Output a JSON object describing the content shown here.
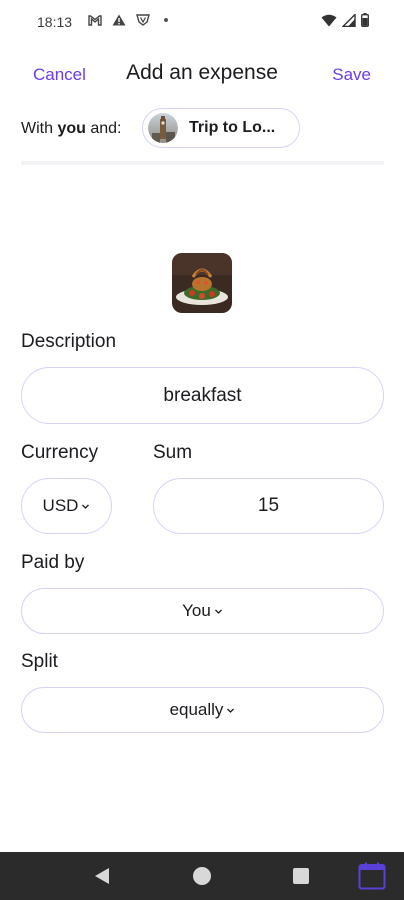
{
  "status_bar": {
    "time": "18:13"
  },
  "header": {
    "cancel_label": "Cancel",
    "title": "Add an expense",
    "save_label": "Save"
  },
  "with_row": {
    "prefix": "With ",
    "you": "you",
    "suffix": " and:",
    "group_name": "Trip to Lo..."
  },
  "form": {
    "description_label": "Description",
    "description_value": "breakfast",
    "currency_label": "Currency",
    "currency_value": "USD",
    "sum_label": "Sum",
    "sum_value": "15",
    "paid_by_label": "Paid by",
    "paid_by_value": "You",
    "split_label": "Split",
    "split_value": "equally"
  },
  "colors": {
    "accent": "#6a3de8",
    "field_border": "#d9d2f7",
    "nav_bar": "#2b2b2b"
  },
  "icons": {
    "status_left": [
      "gmail-icon",
      "warning-icon",
      "shield-icon",
      "dot-icon"
    ],
    "status_right": [
      "wifi-icon",
      "signal-icon",
      "battery-icon"
    ],
    "nav": [
      "back-icon",
      "home-icon",
      "recents-icon",
      "calendar-icon"
    ]
  }
}
